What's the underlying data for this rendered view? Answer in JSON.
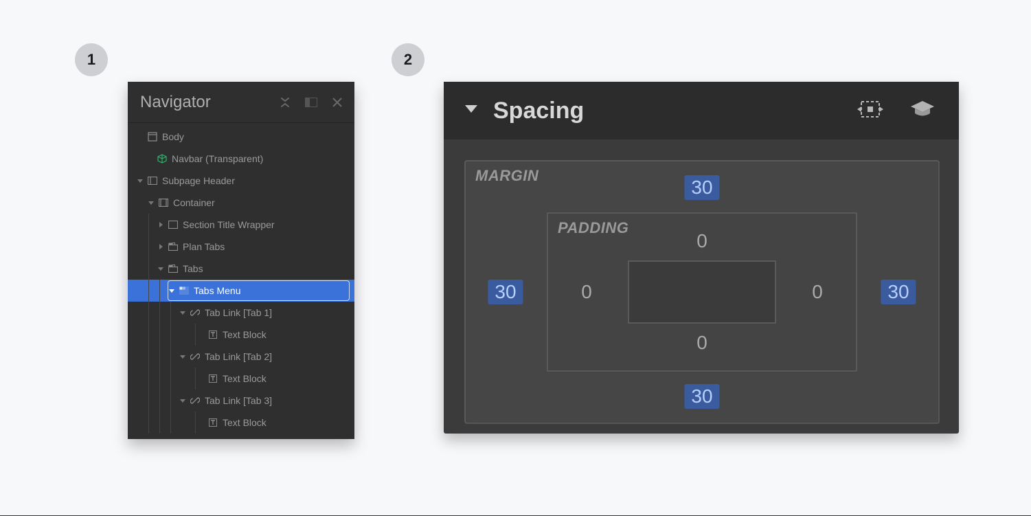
{
  "steps": {
    "one": "1",
    "two": "2"
  },
  "navigator": {
    "title": "Navigator",
    "tree": [
      {
        "label": "Body",
        "indent": 12,
        "icon": "doc",
        "twisty": false,
        "selected": false
      },
      {
        "label": "Navbar (Transparent)",
        "indent": 26,
        "icon": "cube",
        "twisty": false,
        "selected": false,
        "iconColor": "#2fb36e"
      },
      {
        "label": "Subpage Header",
        "indent": 12,
        "icon": "section",
        "twisty": true,
        "selected": false
      },
      {
        "label": "Container",
        "indent": 28,
        "icon": "layout",
        "twisty": true,
        "selected": false
      },
      {
        "label": "Section Title Wrapper",
        "indent": 42,
        "icon": "rect",
        "twisty": true,
        "collapsed": true,
        "selected": false
      },
      {
        "label": "Plan Tabs",
        "indent": 42,
        "icon": "tabs",
        "twisty": true,
        "collapsed": true,
        "selected": false
      },
      {
        "label": "Tabs",
        "indent": 42,
        "icon": "tabs",
        "twisty": true,
        "selected": false
      },
      {
        "label": "Tabs Menu",
        "indent": 58,
        "icon": "tabsmenu",
        "twisty": true,
        "selected": true
      },
      {
        "label": "Tab Link [Tab 1]",
        "indent": 74,
        "icon": "link",
        "twisty": true,
        "selected": false
      },
      {
        "label": "Text Block",
        "indent": 100,
        "icon": "text",
        "twisty": false,
        "selected": false
      },
      {
        "label": "Tab Link [Tab 2]",
        "indent": 74,
        "icon": "link",
        "twisty": true,
        "selected": false
      },
      {
        "label": "Text Block",
        "indent": 100,
        "icon": "text",
        "twisty": false,
        "selected": false
      },
      {
        "label": "Tab Link [Tab 3]",
        "indent": 74,
        "icon": "link",
        "twisty": true,
        "selected": false
      },
      {
        "label": "Text Block",
        "indent": 100,
        "icon": "text",
        "twisty": false,
        "selected": false
      }
    ]
  },
  "spacing": {
    "title": "Spacing",
    "margin_label": "MARGIN",
    "padding_label": "PADDING",
    "margin": {
      "top": "30",
      "right": "30",
      "bottom": "30",
      "left": "30"
    },
    "padding": {
      "top": "0",
      "right": "0",
      "bottom": "0",
      "left": "0"
    }
  }
}
